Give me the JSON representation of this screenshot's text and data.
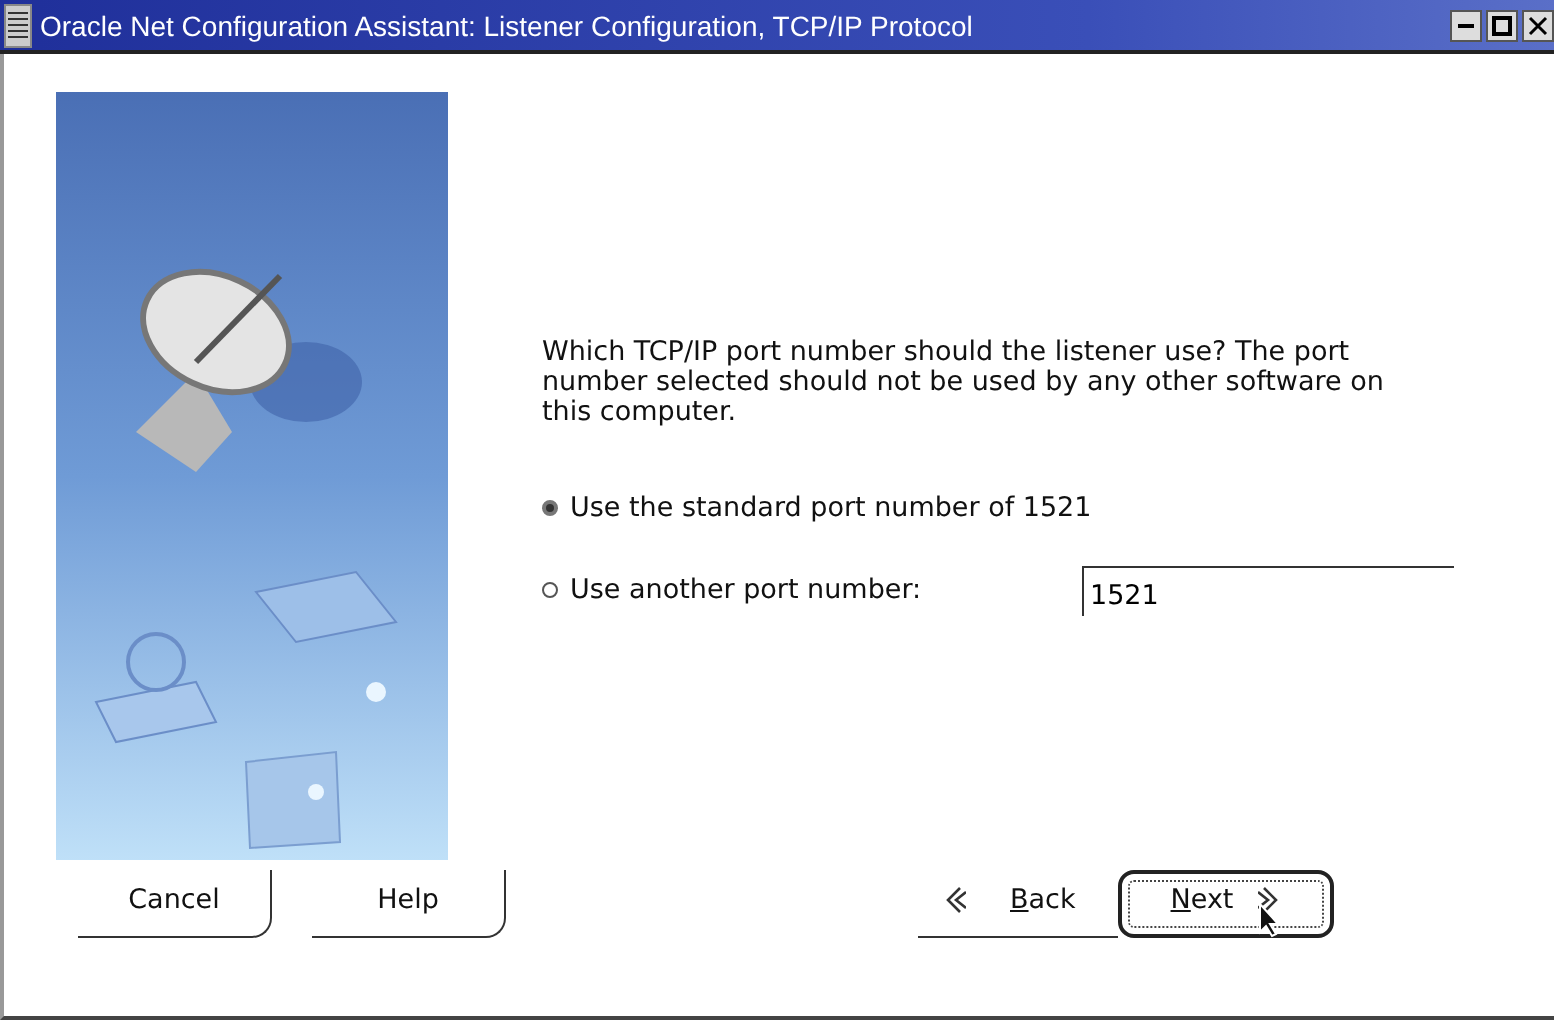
{
  "window": {
    "title": "Oracle Net Configuration Assistant: Listener Configuration, TCP/IP Protocol"
  },
  "prompt": "Which TCP/IP port number should the listener use? The port number selected should not be used by any other software on this computer.",
  "options": [
    {
      "label": "Use the standard port number of 1521",
      "selected": true
    },
    {
      "label": "Use another port number:",
      "selected": false
    }
  ],
  "port_field": {
    "value": "1521"
  },
  "buttons": [
    {
      "label": "Cancel",
      "kind": "plain"
    },
    {
      "label": "Help",
      "kind": "plain"
    },
    {
      "label": "Back",
      "kind": "back"
    },
    {
      "label": "Next",
      "kind": "next"
    }
  ]
}
